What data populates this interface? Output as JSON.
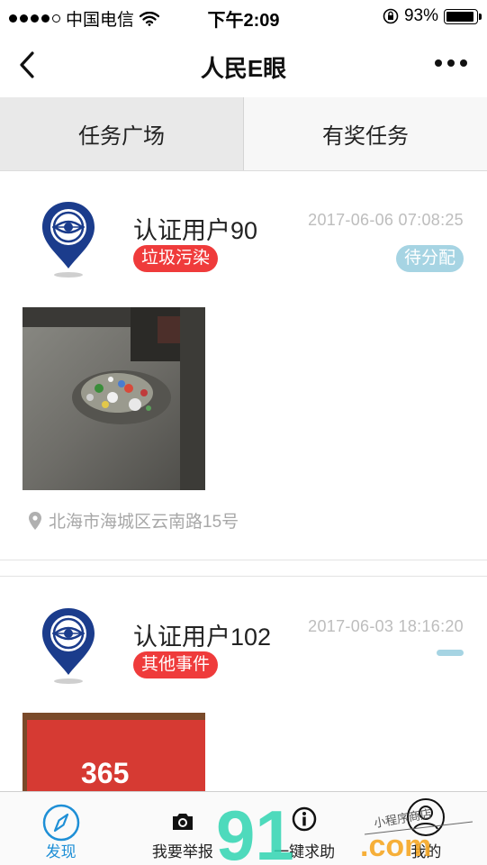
{
  "status_bar": {
    "carrier": "中国电信",
    "time": "下午2:09",
    "battery": "93%",
    "battery_level": 0.93
  },
  "nav": {
    "title": "人民E眼",
    "back_icon": "chevron-left-icon",
    "more_icon": "more-dots-icon"
  },
  "tabs": [
    {
      "label": "任务广场",
      "active": true
    },
    {
      "label": "有奖任务",
      "active": false
    }
  ],
  "posts": [
    {
      "user": "认证用户90",
      "time": "2017-06-06 07:08:25",
      "category": "垃圾污染",
      "status": "待分配",
      "location": "北海市海城区云南路15号",
      "category_color": "#ef3b3b",
      "status_color": "#a6d4e3"
    },
    {
      "user": "认证用户102",
      "time": "2017-06-03 18:16:20",
      "category": "其他事件",
      "status": "",
      "photo_text": "365",
      "category_color": "#ef3b3b",
      "status_color": "#a6d4e3"
    }
  ],
  "tabbar": [
    {
      "label": "发现",
      "icon": "compass-icon",
      "active": true
    },
    {
      "label": "我要举报",
      "icon": "camera-icon",
      "active": false
    },
    {
      "label": "一键求助",
      "icon": "info-icon",
      "active": false
    },
    {
      "label": "我的",
      "icon": "user-icon",
      "active": false
    }
  ],
  "watermark": {
    "brand": "91",
    "suffix": ".com",
    "handwriting": "小程序商店"
  },
  "colors": {
    "accent": "#1e8fd6",
    "tag_red": "#ef3b3b",
    "logo_blue": "#1b3c8c"
  }
}
